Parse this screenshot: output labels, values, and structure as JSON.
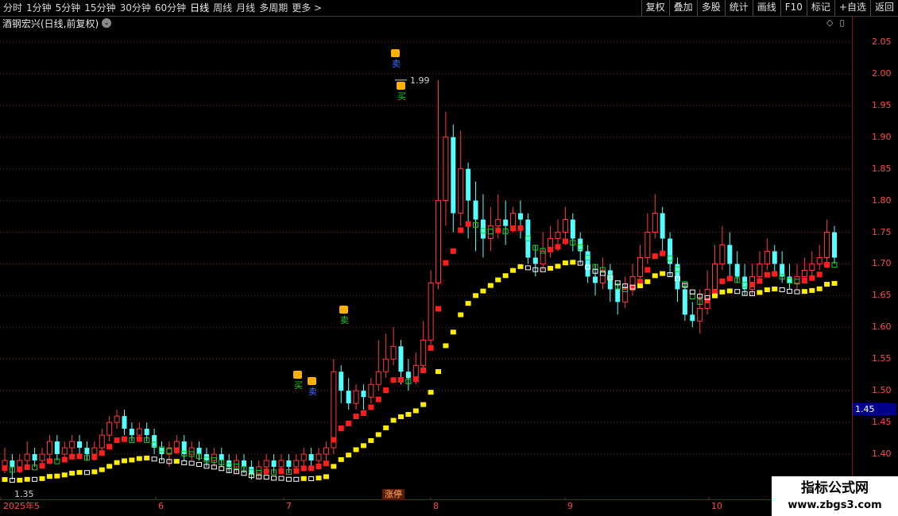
{
  "toolbar": {
    "periods": [
      "分时",
      "1分钟",
      "5分钟",
      "15分钟",
      "30分钟",
      "60分钟",
      "日线",
      "周线",
      "月线",
      "多周期",
      "更多 >"
    ],
    "active_period": "日线",
    "buttons": [
      "复权",
      "叠加",
      "多股",
      "统计",
      "画线",
      "F10",
      "标记",
      "+自选",
      "返回"
    ]
  },
  "chart": {
    "title": "酒钢宏兴(日线,前复权)",
    "high_label": "1.99",
    "low_label": "1.35",
    "current_price": "1.45",
    "zt_label": "涨停",
    "signals": [
      "卖",
      "买",
      "卖",
      "买",
      "卖",
      "卖"
    ]
  },
  "price_axis": {
    "ticks": [
      "2.05",
      "2.00",
      "1.95",
      "1.90",
      "1.85",
      "1.80",
      "1.75",
      "1.70",
      "1.65",
      "1.60",
      "1.55",
      "1.50",
      "1.45",
      "1.40"
    ],
    "range": [
      1.35,
      2.08
    ]
  },
  "date_axis": {
    "labels": [
      "2025年5",
      "6",
      "7",
      "8",
      "9",
      "10"
    ]
  },
  "watermark": {
    "title": "指标公式网",
    "url": "www.zbgs3.com"
  },
  "colors": {
    "up": "#ff3b3b",
    "down": "#54ffff",
    "band_red": "#ff1e1e",
    "band_yellow": "#ffee00",
    "band_green": "#22cc22",
    "band_white": "#ffffff",
    "grid": "#7a1a1a",
    "axis_text": "#ff4a4a"
  },
  "chart_data": {
    "type": "candlestick",
    "candles": [
      [
        1.38,
        1.39,
        1.41,
        1.37
      ],
      [
        1.39,
        1.38,
        1.4,
        1.36
      ],
      [
        1.38,
        1.39,
        1.4,
        1.37
      ],
      [
        1.39,
        1.4,
        1.42,
        1.38
      ],
      [
        1.4,
        1.39,
        1.41,
        1.38
      ],
      [
        1.39,
        1.4,
        1.41,
        1.38
      ],
      [
        1.4,
        1.42,
        1.43,
        1.39
      ],
      [
        1.42,
        1.4,
        1.43,
        1.39
      ],
      [
        1.4,
        1.41,
        1.42,
        1.39
      ],
      [
        1.41,
        1.42,
        1.43,
        1.4
      ],
      [
        1.42,
        1.41,
        1.43,
        1.4
      ],
      [
        1.41,
        1.4,
        1.42,
        1.39
      ],
      [
        1.4,
        1.41,
        1.42,
        1.39
      ],
      [
        1.41,
        1.43,
        1.44,
        1.4
      ],
      [
        1.43,
        1.45,
        1.46,
        1.42
      ],
      [
        1.45,
        1.46,
        1.47,
        1.44
      ],
      [
        1.46,
        1.44,
        1.47,
        1.43
      ],
      [
        1.44,
        1.43,
        1.45,
        1.42
      ],
      [
        1.43,
        1.44,
        1.45,
        1.42
      ],
      [
        1.44,
        1.43,
        1.45,
        1.42
      ],
      [
        1.43,
        1.41,
        1.44,
        1.4
      ],
      [
        1.41,
        1.4,
        1.42,
        1.39
      ],
      [
        1.4,
        1.41,
        1.42,
        1.38
      ],
      [
        1.41,
        1.42,
        1.43,
        1.4
      ],
      [
        1.42,
        1.4,
        1.43,
        1.39
      ],
      [
        1.4,
        1.41,
        1.42,
        1.39
      ],
      [
        1.41,
        1.4,
        1.42,
        1.39
      ],
      [
        1.4,
        1.39,
        1.41,
        1.38
      ],
      [
        1.39,
        1.4,
        1.41,
        1.38
      ],
      [
        1.4,
        1.39,
        1.41,
        1.38
      ],
      [
        1.39,
        1.38,
        1.4,
        1.37
      ],
      [
        1.38,
        1.39,
        1.4,
        1.37
      ],
      [
        1.39,
        1.38,
        1.4,
        1.37
      ],
      [
        1.38,
        1.37,
        1.39,
        1.36
      ],
      [
        1.37,
        1.38,
        1.39,
        1.36
      ],
      [
        1.38,
        1.39,
        1.4,
        1.37
      ],
      [
        1.39,
        1.38,
        1.4,
        1.37
      ],
      [
        1.38,
        1.39,
        1.4,
        1.37
      ],
      [
        1.39,
        1.38,
        1.4,
        1.37
      ],
      [
        1.38,
        1.39,
        1.4,
        1.37
      ],
      [
        1.39,
        1.4,
        1.41,
        1.38
      ],
      [
        1.4,
        1.39,
        1.41,
        1.38
      ],
      [
        1.39,
        1.4,
        1.41,
        1.38
      ],
      [
        1.4,
        1.41,
        1.42,
        1.39
      ],
      [
        1.41,
        1.53,
        1.55,
        1.4
      ],
      [
        1.53,
        1.5,
        1.54,
        1.48
      ],
      [
        1.5,
        1.48,
        1.52,
        1.47
      ],
      [
        1.48,
        1.5,
        1.51,
        1.47
      ],
      [
        1.5,
        1.49,
        1.51,
        1.47
      ],
      [
        1.49,
        1.51,
        1.52,
        1.48
      ],
      [
        1.51,
        1.53,
        1.58,
        1.5
      ],
      [
        1.53,
        1.55,
        1.59,
        1.52
      ],
      [
        1.55,
        1.57,
        1.6,
        1.54
      ],
      [
        1.57,
        1.53,
        1.58,
        1.51
      ],
      [
        1.53,
        1.52,
        1.55,
        1.5
      ],
      [
        1.52,
        1.54,
        1.56,
        1.51
      ],
      [
        1.54,
        1.58,
        1.61,
        1.53
      ],
      [
        1.58,
        1.67,
        1.69,
        1.57
      ],
      [
        1.67,
        1.8,
        1.99,
        1.66
      ],
      [
        1.8,
        1.9,
        1.94,
        1.76
      ],
      [
        1.9,
        1.78,
        1.92,
        1.75
      ],
      [
        1.78,
        1.85,
        1.91,
        1.76
      ],
      [
        1.85,
        1.8,
        1.86,
        1.74
      ],
      [
        1.8,
        1.77,
        1.83,
        1.72
      ],
      [
        1.77,
        1.74,
        1.81,
        1.71
      ],
      [
        1.74,
        1.76,
        1.79,
        1.72
      ],
      [
        1.76,
        1.77,
        1.81,
        1.74
      ],
      [
        1.77,
        1.76,
        1.8,
        1.73
      ],
      [
        1.76,
        1.78,
        1.79,
        1.75
      ],
      [
        1.78,
        1.77,
        1.8,
        1.74
      ],
      [
        1.77,
        1.71,
        1.78,
        1.7
      ],
      [
        1.71,
        1.7,
        1.73,
        1.68
      ],
      [
        1.7,
        1.72,
        1.75,
        1.69
      ],
      [
        1.72,
        1.74,
        1.76,
        1.71
      ],
      [
        1.74,
        1.75,
        1.77,
        1.72
      ],
      [
        1.75,
        1.77,
        1.79,
        1.73
      ],
      [
        1.77,
        1.74,
        1.78,
        1.72
      ],
      [
        1.74,
        1.72,
        1.75,
        1.7
      ],
      [
        1.72,
        1.68,
        1.73,
        1.67
      ],
      [
        1.68,
        1.67,
        1.7,
        1.65
      ],
      [
        1.67,
        1.69,
        1.71,
        1.66
      ],
      [
        1.69,
        1.66,
        1.7,
        1.64
      ],
      [
        1.66,
        1.64,
        1.67,
        1.62
      ],
      [
        1.64,
        1.66,
        1.68,
        1.63
      ],
      [
        1.66,
        1.68,
        1.7,
        1.65
      ],
      [
        1.68,
        1.71,
        1.73,
        1.67
      ],
      [
        1.71,
        1.75,
        1.78,
        1.7
      ],
      [
        1.75,
        1.78,
        1.81,
        1.74
      ],
      [
        1.78,
        1.74,
        1.79,
        1.72
      ],
      [
        1.74,
        1.7,
        1.75,
        1.68
      ],
      [
        1.7,
        1.66,
        1.71,
        1.64
      ],
      [
        1.66,
        1.62,
        1.67,
        1.61
      ],
      [
        1.62,
        1.61,
        1.64,
        1.6
      ],
      [
        1.61,
        1.63,
        1.66,
        1.59
      ],
      [
        1.63,
        1.66,
        1.69,
        1.62
      ],
      [
        1.66,
        1.7,
        1.73,
        1.65
      ],
      [
        1.7,
        1.73,
        1.76,
        1.69
      ],
      [
        1.73,
        1.7,
        1.75,
        1.68
      ],
      [
        1.7,
        1.68,
        1.72,
        1.67
      ],
      [
        1.68,
        1.66,
        1.7,
        1.65
      ],
      [
        1.66,
        1.68,
        1.7,
        1.65
      ],
      [
        1.68,
        1.7,
        1.72,
        1.67
      ],
      [
        1.7,
        1.72,
        1.74,
        1.69
      ],
      [
        1.72,
        1.7,
        1.73,
        1.68
      ],
      [
        1.7,
        1.68,
        1.72,
        1.67
      ],
      [
        1.68,
        1.67,
        1.7,
        1.66
      ],
      [
        1.67,
        1.68,
        1.7,
        1.66
      ],
      [
        1.68,
        1.69,
        1.71,
        1.67
      ],
      [
        1.69,
        1.7,
        1.72,
        1.68
      ],
      [
        1.7,
        1.71,
        1.73,
        1.69
      ],
      [
        1.71,
        1.75,
        1.77,
        1.7
      ],
      [
        1.75,
        1.71,
        1.76,
        1.7
      ]
    ]
  }
}
